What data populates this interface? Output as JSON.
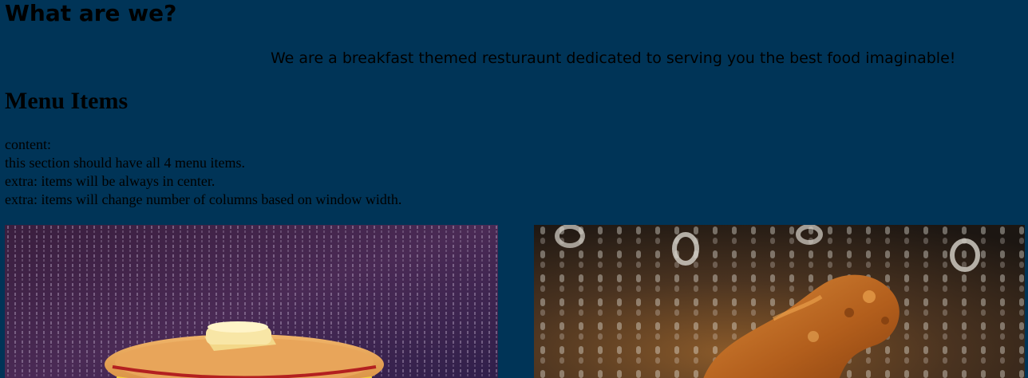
{
  "about": {
    "title": "What are we?",
    "text": "We are a breakfast themed resturaunt dedicated to serving you the best food imaginable!"
  },
  "menu": {
    "title": "Menu Items",
    "notes": [
      "content:",
      "this section should have all 4 menu items.",
      "extra: items will be always in center.",
      "extra: items will change number of columns based on window width."
    ],
    "items": [
      {
        "image": "pancake-stack-image"
      },
      {
        "image": "fried-chicken-image"
      }
    ]
  },
  "colors": {
    "page_background": "#003457"
  }
}
